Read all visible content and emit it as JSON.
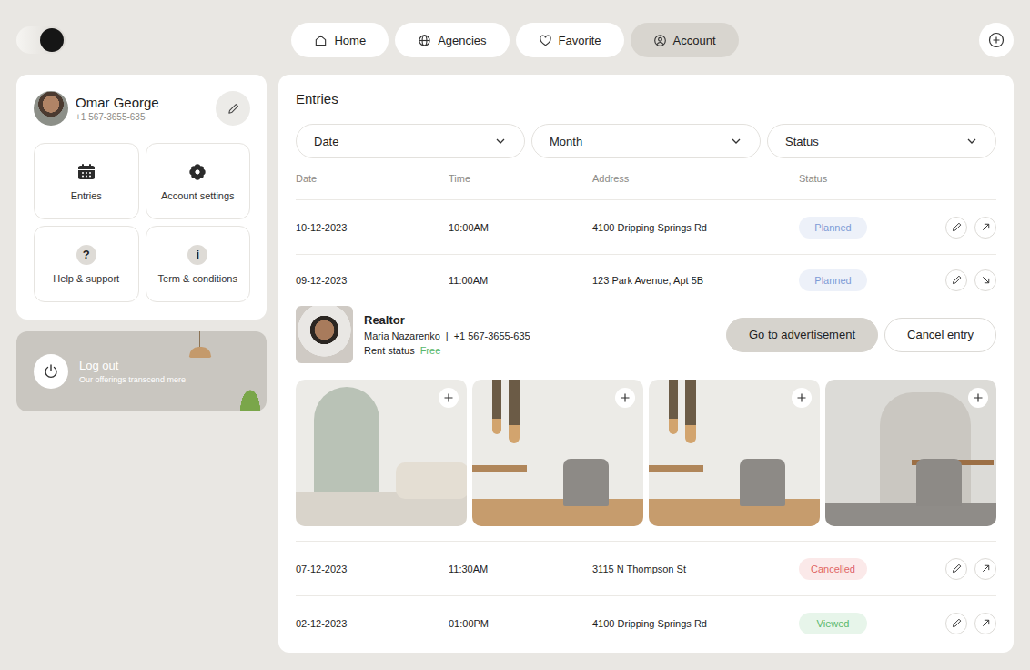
{
  "theme_toggle": {
    "on": true
  },
  "nav": [
    {
      "label": "Home",
      "kind": "home",
      "selected": false
    },
    {
      "label": "Agencies",
      "kind": "globe",
      "selected": false
    },
    {
      "label": "Favorite",
      "kind": "heart",
      "selected": false
    },
    {
      "label": "Account",
      "kind": "user",
      "selected": true
    }
  ],
  "profile": {
    "name": "Omar George",
    "phone": "+1 567-3655-635"
  },
  "menu": [
    {
      "label": "Entries",
      "kind": "calendar",
      "glyph": ""
    },
    {
      "label": "Account settings",
      "kind": "gear",
      "glyph": ""
    },
    {
      "label": "Help & support",
      "kind": "glyph",
      "glyph": "?"
    },
    {
      "label": "Term & conditions",
      "kind": "glyph",
      "glyph": "i"
    }
  ],
  "logout": {
    "title": "Log out",
    "subtitle": "Our offerings transcend mere"
  },
  "entries": {
    "title": "Entries",
    "filters": [
      "Date",
      "Month",
      "Status"
    ],
    "columns": [
      "Date",
      "Time",
      "Address",
      "Status"
    ],
    "rows": [
      {
        "date": "10-12-2023",
        "time": "10:00AM",
        "address": "4100 Dripping Springs Rd",
        "status": "Planned",
        "color": "#7d9bd6",
        "expanded": false
      },
      {
        "date": "09-12-2023",
        "time": "11:00AM",
        "address": "123 Park Avenue, Apt 5B",
        "status": "Planned",
        "color": "#7d9bd6",
        "expanded": true,
        "details": {
          "label": "Realtor",
          "name": "Maria Nazarenko",
          "separator": "|",
          "phone": "+1 567-3655-635",
          "rent_label": "Rent status",
          "rent_value": "Free",
          "buttons": [
            "Go to advertisement",
            "Cancel entry"
          ],
          "photos": [
            {
              "kind": "arch"
            },
            {
              "kind": "lamps"
            },
            {
              "kind": "lamps"
            },
            {
              "kind": "shelf"
            }
          ]
        }
      },
      {
        "date": "07-12-2023",
        "time": "11:30AM",
        "address": "3115 N Thompson St",
        "status": "Cancelled",
        "color": "#e06666",
        "expanded": false
      },
      {
        "date": "02-12-2023",
        "time": "01:00PM",
        "address": "4100 Dripping Springs Rd",
        "status": "Viewed",
        "color": "#58b86c",
        "expanded": false
      }
    ]
  }
}
